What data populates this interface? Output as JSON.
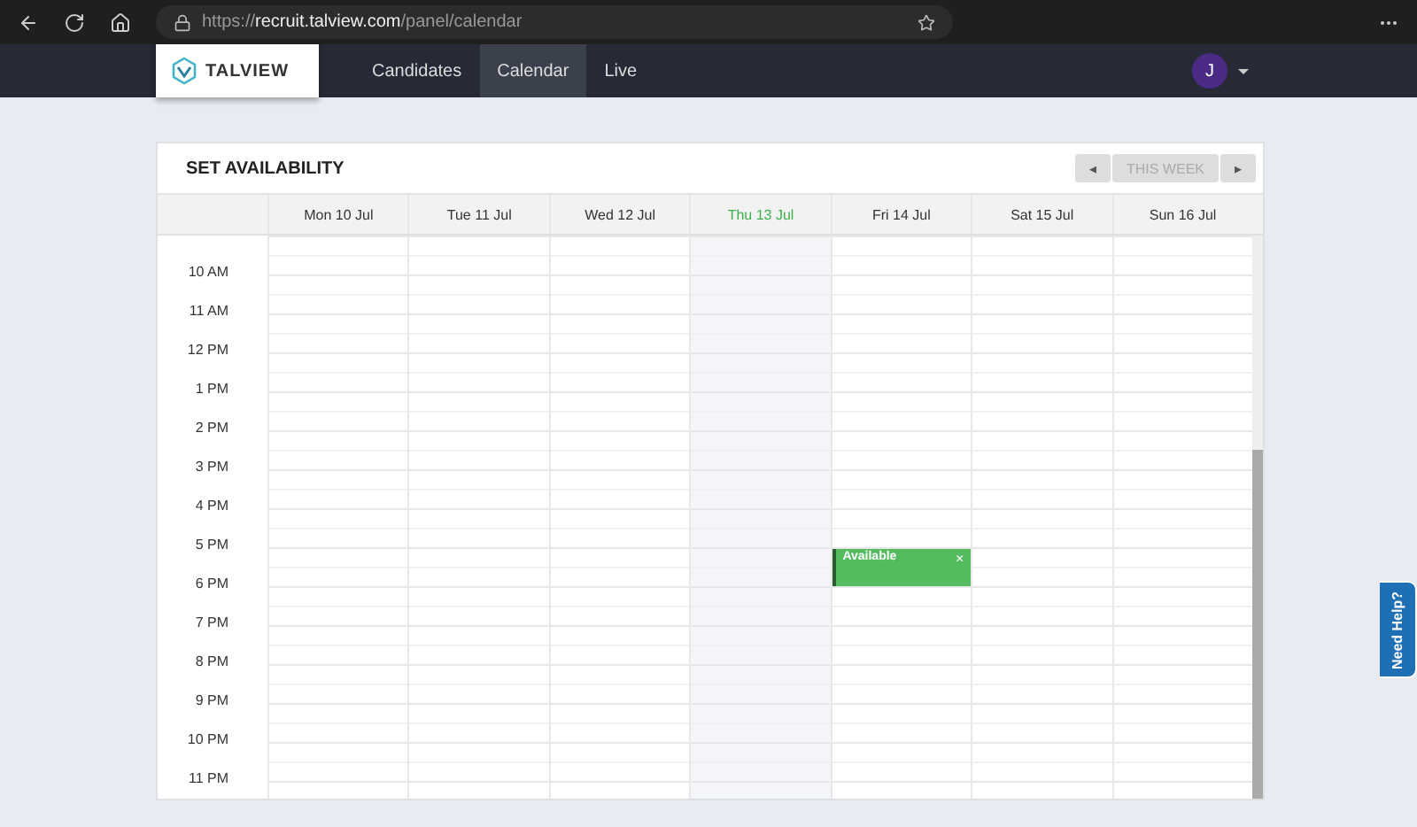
{
  "browser": {
    "url_prefix": "https://",
    "url_host": "recruit.talview.com",
    "url_path": "/panel/calendar"
  },
  "app": {
    "logo_text": "TALVIEW",
    "nav": [
      {
        "label": "Candidates",
        "selected": false
      },
      {
        "label": "Calendar",
        "selected": true
      },
      {
        "label": "Live",
        "selected": false
      }
    ],
    "user_initial": "J"
  },
  "calendar": {
    "title": "SET AVAILABILITY",
    "prev": {
      "label": "◂"
    },
    "this_week": {
      "label": "THIS WEEK",
      "disabled": true
    },
    "next": {
      "label": "▸"
    },
    "days": [
      {
        "label": "Mon 10 Jul",
        "today": false
      },
      {
        "label": "Tue 11 Jul",
        "today": false
      },
      {
        "label": "Wed 12 Jul",
        "today": false
      },
      {
        "label": "Thu 13 Jul",
        "today": true
      },
      {
        "label": "Fri 14 Jul",
        "today": false
      },
      {
        "label": "Sat 15 Jul",
        "today": false
      },
      {
        "label": "Sun 16 Jul",
        "today": false
      }
    ],
    "event": {
      "label": "Available",
      "close": "×"
    },
    "hours": [
      {
        "label": "10 AM",
        "available": [
          false,
          false,
          false,
          false,
          false,
          false,
          false
        ]
      },
      {
        "label": "11 AM",
        "available": [
          false,
          false,
          false,
          false,
          false,
          false,
          false
        ]
      },
      {
        "label": "12 PM",
        "available": [
          false,
          false,
          false,
          false,
          false,
          false,
          false
        ]
      },
      {
        "label": "1 PM",
        "available": [
          false,
          false,
          false,
          false,
          false,
          false,
          false
        ]
      },
      {
        "label": "2 PM",
        "available": [
          false,
          false,
          false,
          false,
          false,
          false,
          false
        ]
      },
      {
        "label": "3 PM",
        "available": [
          false,
          false,
          false,
          false,
          false,
          false,
          false
        ]
      },
      {
        "label": "4 PM",
        "available": [
          false,
          false,
          false,
          false,
          false,
          false,
          false
        ]
      },
      {
        "label": "5 PM",
        "available": [
          false,
          false,
          false,
          false,
          true,
          false,
          false
        ]
      },
      {
        "label": "6 PM",
        "available": [
          false,
          false,
          false,
          false,
          false,
          false,
          false
        ]
      },
      {
        "label": "7 PM",
        "available": [
          false,
          false,
          false,
          false,
          false,
          false,
          false
        ]
      },
      {
        "label": "8 PM",
        "available": [
          false,
          false,
          false,
          false,
          false,
          false,
          false
        ]
      },
      {
        "label": "9 PM",
        "available": [
          false,
          false,
          false,
          false,
          false,
          false,
          false
        ]
      },
      {
        "label": "10 PM",
        "available": [
          false,
          false,
          false,
          false,
          false,
          false,
          false
        ]
      },
      {
        "label": "11 PM",
        "available": [
          false,
          false,
          false,
          false,
          false,
          false,
          false
        ]
      }
    ]
  },
  "help": {
    "label": "Need Help?"
  }
}
